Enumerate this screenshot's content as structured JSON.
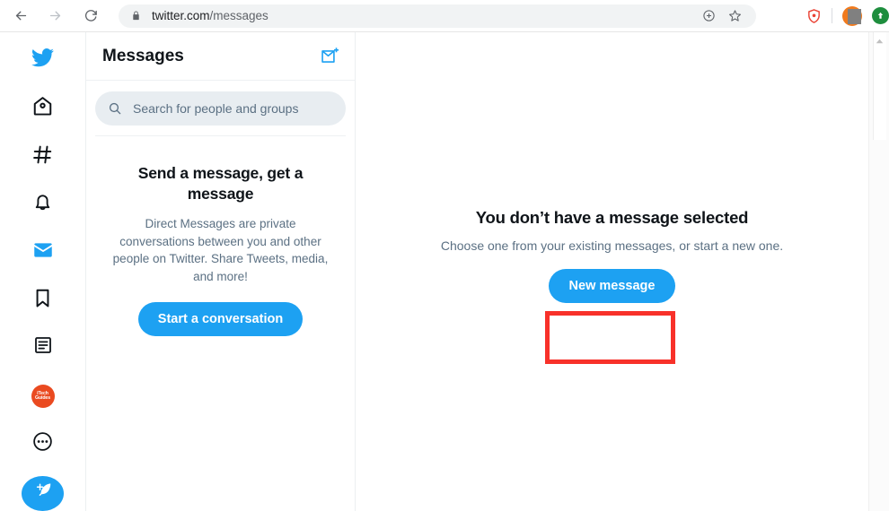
{
  "browser": {
    "back_icon": "arrow-left-icon",
    "forward_icon": "arrow-right-icon",
    "reload_icon": "reload-icon",
    "lock_icon": "padlock-icon",
    "url_domain": "twitter.com",
    "url_path": "/messages",
    "url_full": "twitter.com/messages",
    "install_icon": "install-app-icon",
    "bookmark_icon": "star-icon",
    "extensions": [
      {
        "name": "adblock-shield-icon",
        "color": "#ea4335"
      },
      {
        "name": "profile-avatar-icon",
        "color": "#f07a1e"
      },
      {
        "name": "green-circle-extension-icon",
        "color": "#1e8e3e"
      }
    ]
  },
  "sidebar": {
    "items": [
      {
        "name": "twitter-logo-icon",
        "label": "Twitter"
      },
      {
        "name": "home-icon",
        "label": "Home"
      },
      {
        "name": "explore-hashtag-icon",
        "label": "Explore"
      },
      {
        "name": "notifications-bell-icon",
        "label": "Notifications"
      },
      {
        "name": "messages-envelope-icon",
        "label": "Messages",
        "active": true
      },
      {
        "name": "bookmarks-icon",
        "label": "Bookmarks"
      },
      {
        "name": "lists-icon",
        "label": "Lists"
      },
      {
        "name": "profile-avatar",
        "label": "iTech Guides"
      },
      {
        "name": "more-ellipsis-icon",
        "label": "More"
      }
    ],
    "avatar_line1": "iTech",
    "avatar_line2": "Guides",
    "compose": {
      "icon": "compose-tweet-icon",
      "label": "Tweet"
    }
  },
  "dm_panel": {
    "title": "Messages",
    "new_message_icon": "new-message-envelope-plus-icon",
    "search": {
      "icon": "search-icon",
      "placeholder": "Search for people and groups",
      "value": ""
    },
    "empty": {
      "heading": "Send a message, get a message",
      "body": "Direct Messages are private conversations between you and other people on Twitter. Share Tweets, media, and more!",
      "button": "Start a conversation"
    }
  },
  "main": {
    "heading": "You don’t have a message selected",
    "subtext": "Choose one from your existing messages, or start a new one.",
    "button": "New message",
    "highlight_color": "#f8312a"
  },
  "theme": {
    "twitter_blue": "#1da1f2",
    "text_primary": "#0f1419",
    "text_secondary": "#5b7083",
    "search_bg": "#e8edf1"
  }
}
